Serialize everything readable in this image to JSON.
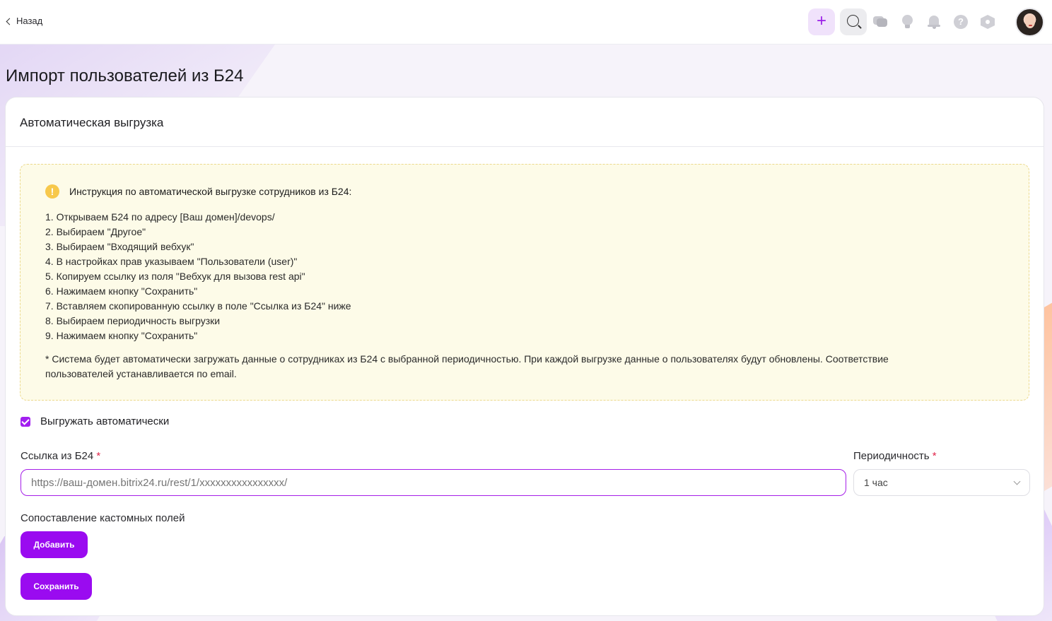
{
  "topbar": {
    "back_label": "Назад",
    "add_symbol": "+",
    "help_symbol": "?"
  },
  "page": {
    "title": "Импорт пользователей из Б24"
  },
  "card": {
    "title": "Автоматическая выгрузка",
    "notice": {
      "icon": "!",
      "title": "Инструкция по автоматической выгрузке сотрудников из Б24:",
      "steps": [
        "1. Открываем Б24 по адресу [Ваш домен]/devops/",
        "2. Выбираем \"Другое\"",
        "3. Выбираем \"Входящий вебхук\"",
        "4. В настройках прав указываем \"Пользователи (user)\"",
        "5. Копируем ссылку из поля \"Вебхук для вызова rest api\"",
        "6. Нажимаем кнопку \"Сохранить\"",
        "7. Вставляем скопированную ссылку в поле \"Ссылка из Б24\" ниже",
        "8. Выбираем периодичность выгрузки",
        "9. Нажимаем кнопку \"Сохранить\""
      ],
      "footnote": "* Система будет автоматически загружать данные о сотрудниках из Б24 с выбранной периодичностью. При каждой выгрузке данные о пользователях будут обновлены. Соответствие пользователей устанавливается по email."
    },
    "auto_checkbox": {
      "label": "Выгружать автоматически",
      "checked": true
    },
    "url_field": {
      "label": "Ссылка из Б24",
      "required_mark": "*",
      "placeholder": "https://ваш-домен.bitrix24.ru/rest/1/xxxxxxxxxxxxxxxx/"
    },
    "period_field": {
      "label": "Периодичность",
      "required_mark": "*",
      "value": "1 час"
    },
    "custom_fields": {
      "label": "Сопоставление кастомных полей",
      "add_button": "Добавить"
    },
    "save_button": "Сохранить"
  },
  "colors": {
    "accent": "#9a0bf0",
    "notice_bg": "#fdfbe8",
    "warning": "#f7c84b",
    "required": "#e0254a"
  },
  "icons": [
    "chevron-left-icon",
    "plus-icon",
    "search-icon",
    "chat-icon",
    "lightbulb-icon",
    "bell-icon",
    "help-icon",
    "settings-hex-icon",
    "warning-icon",
    "checkmark-icon",
    "chevron-down-icon"
  ]
}
